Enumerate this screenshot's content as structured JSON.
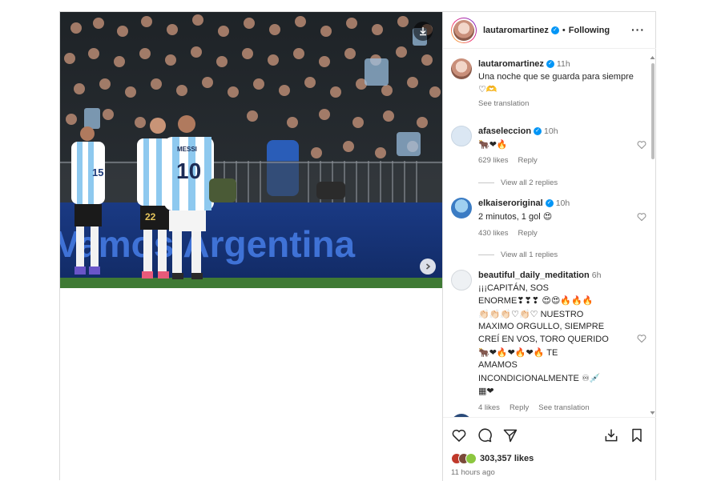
{
  "header": {
    "username": "lautaromartinez",
    "separator": "•",
    "follow_status": "Following"
  },
  "photo": {
    "banner_text": "Vamos Argentina",
    "jersey_left": "15",
    "jersey_mid": "22",
    "jersey_right_name": "MESSI",
    "jersey_right_number": "10"
  },
  "comments": [
    {
      "username": "lautaromartinez",
      "time": "11h",
      "text": "Una noche que se guarda para siempre",
      "emoji": "♡🫶",
      "translation": "See translation"
    },
    {
      "username": "afaseleccion",
      "time": "10h",
      "emoji": "🐂❤🔥",
      "likes": "629 likes",
      "reply": "Reply",
      "view_replies": "View all 2 replies"
    },
    {
      "username": "elkaiseroriginal",
      "time": "10h",
      "text": "2 minutos, 1 gol",
      "emoji": "😍",
      "likes": "430 likes",
      "reply": "Reply",
      "view_replies": "View all 1 replies"
    },
    {
      "username": "beautiful_daily_meditation",
      "time": "6h",
      "line1": "¡¡¡CAPITÁN, SOS",
      "line2": "ENORME",
      "line2_emoji": "❣❣❣ 😍😍🔥🔥🔥",
      "line3_emoji": "👏🏻👏🏻👏🏻♡👏🏻♡",
      "line3": "NUESTRO",
      "line4": "MAXIMO ORGULLO, SIEMPRE",
      "line5": "CREÍ EN VOS, TORO QUERIDO",
      "line6_emoji": "🐂❤🔥❤🔥❤🔥",
      "line6": "TE",
      "line7": "AMAMOS",
      "line8": "INCONDICIONALMENTE",
      "line8_emoji": "♾💉",
      "line9_emoji": "▦❤",
      "likes": "4 likes",
      "reply": "Reply",
      "translation": "See translation"
    }
  ],
  "footer": {
    "likes_count": "303,357 likes",
    "time_ago": "11 hours ago"
  },
  "colors": {
    "verified": "#0095f6",
    "pitch_blue": "#1b3d8a",
    "stripe": "#8ec9ef"
  }
}
